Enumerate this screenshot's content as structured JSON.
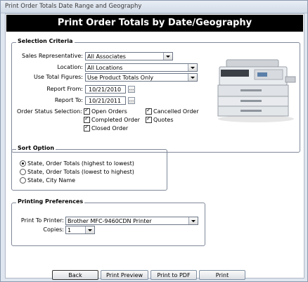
{
  "window": {
    "title": "Print Order Totals Date Range and Geography"
  },
  "banner": {
    "title": "Print Order Totals by Date/Geography"
  },
  "selection": {
    "title": "Selection Criteria",
    "sales_rep_label": "Sales Representative:",
    "sales_rep_value": "All Associates",
    "location_label": "Location:",
    "location_value": "All Locations",
    "use_total_label": "Use Total Figures:",
    "use_total_value": "Use Product Totals Only",
    "report_from_label": "Report From:",
    "report_from_value": "10/21/2010",
    "report_to_label": "Report To:",
    "report_to_value": "10/21/2011",
    "dots": "...",
    "order_status_label": "Order Status Selection:",
    "statuses": [
      {
        "label": "Open Orders",
        "checked": true
      },
      {
        "label": "Completed Order",
        "checked": true
      },
      {
        "label": "Closed Order",
        "checked": true
      },
      {
        "label": "Cancelled Order",
        "checked": true
      },
      {
        "label": "Quotes",
        "checked": true
      }
    ]
  },
  "sort": {
    "title": "Sort Option",
    "options": [
      {
        "label": "State, Order Totals (highest to lowest)",
        "selected": true
      },
      {
        "label": "State, Order Totals (lowest to highest)",
        "selected": false
      },
      {
        "label": "State, City Name",
        "selected": false
      }
    ]
  },
  "printing": {
    "title": "Printing Preferences",
    "printer_label": "Print To Printer:",
    "printer_value": "Brother MFC-9460CDN Printer",
    "copies_label": "Copies:",
    "copies_value": "1"
  },
  "buttons": {
    "back": "Back",
    "preview": "Print Preview",
    "pdf": "Print to PDF",
    "print": "Print"
  }
}
